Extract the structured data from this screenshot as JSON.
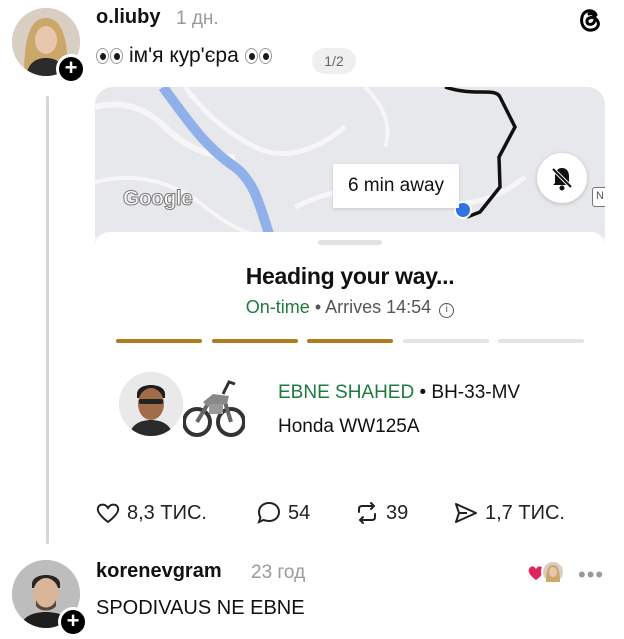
{
  "post": {
    "username": "o.liuby",
    "time": "1 дн.",
    "caption": "ім'я кур'єра",
    "pager": "1/2",
    "card": {
      "eta_label": "6 min away",
      "google_label": "Google",
      "n_badge": "N",
      "heading": "Heading your way...",
      "ontime": "On-time",
      "arrives": " • Arrives 14:54",
      "info_glyph": "i",
      "progress_filled_segments": 3,
      "progress_total_segments": 5,
      "driver_name": "EBNE SHAHED",
      "plate": " • BH-33-MV",
      "vehicle": "Honda WW125A"
    },
    "actions": {
      "likes": "8,3 ТИС.",
      "comments": "54",
      "reposts": "39",
      "shares": "1,7 ТИС."
    }
  },
  "reply": {
    "username": "korenevgram",
    "time": "23 год",
    "text": "SPODIVAUS NE EBNE",
    "more": "•••"
  },
  "colors": {
    "accent_green": "#1f7a3d",
    "progress_brown": "#b07a1e",
    "progress_empty": "#e4e4e4",
    "heart_red": "#e0245e",
    "route_blue": "#8fb0e8"
  }
}
